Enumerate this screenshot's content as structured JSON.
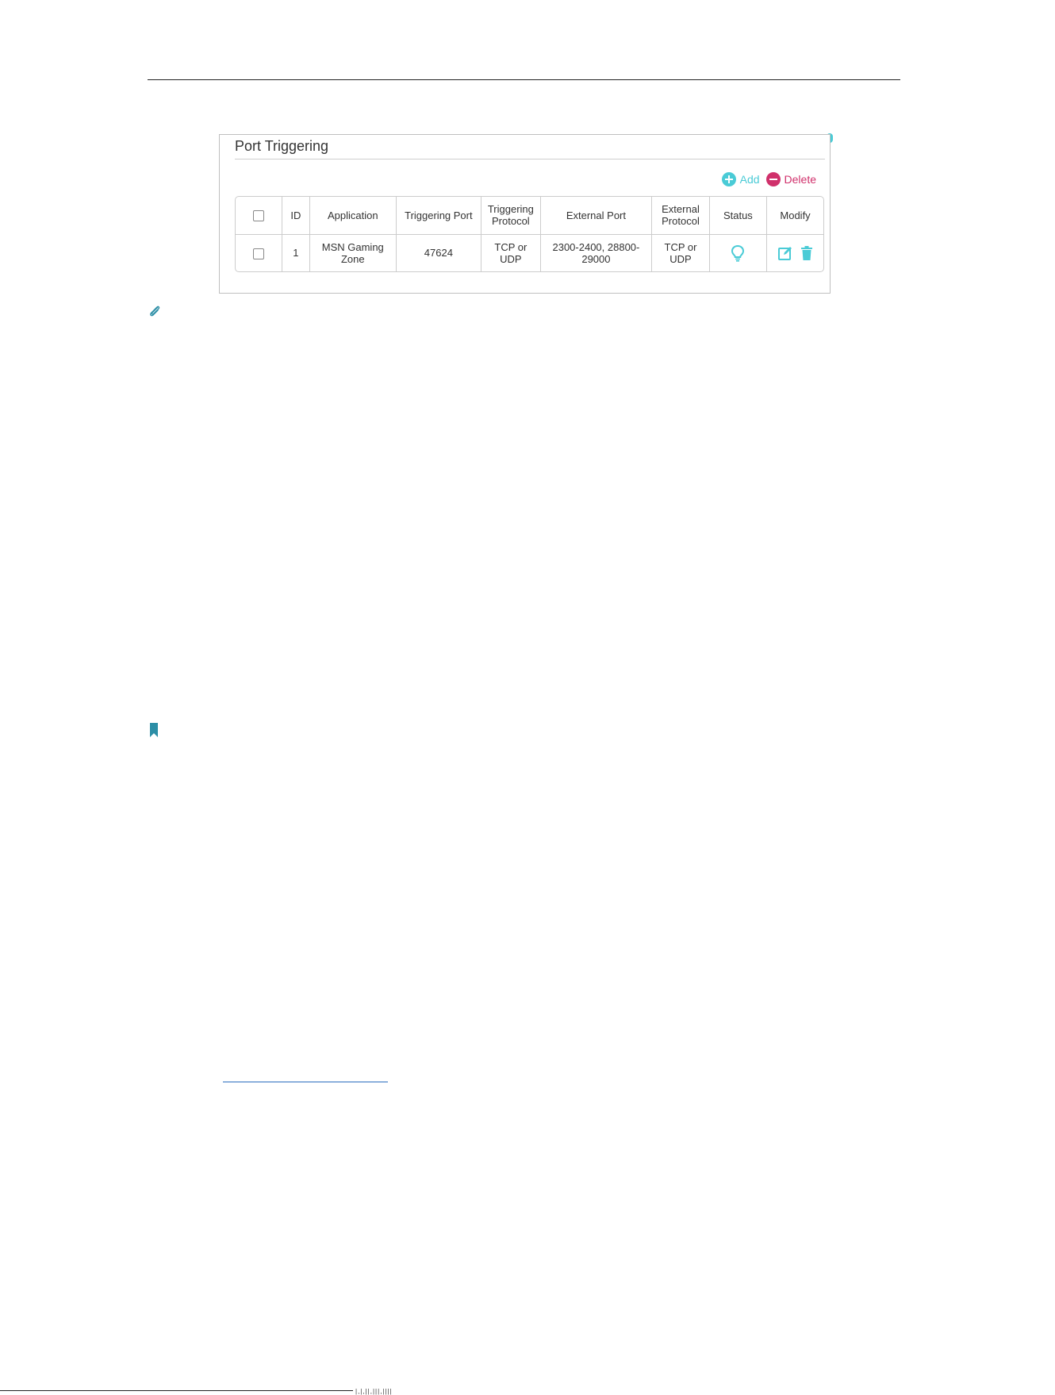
{
  "panel": {
    "title": "Port Triggering",
    "add_label": "Add",
    "delete_label": "Delete"
  },
  "table": {
    "headers": {
      "id": "ID",
      "application": "Application",
      "triggering_port": "Triggering Port",
      "triggering_protocol": "Triggering Protocol",
      "external_port": "External Port",
      "external_protocol": "External Protocol",
      "status": "Status",
      "modify": "Modify"
    },
    "rows": [
      {
        "id": "1",
        "application": "MSN Gaming Zone",
        "triggering_port": "47624",
        "triggering_protocol": "TCP or UDP",
        "external_port": "2300-2400, 28800-29000",
        "external_protocol": "TCP or UDP",
        "status_icon": "lightbulb-icon",
        "modify_icons": [
          "edit-icon",
          "trash-icon"
        ]
      }
    ]
  },
  "footer": {
    "glyphs": "|,|,||,|||,||||"
  },
  "colors": {
    "accent": "#4acbd6",
    "danger": "#d0306b",
    "bookmark": "#2c8ea6",
    "link": "#2c6fbf"
  }
}
